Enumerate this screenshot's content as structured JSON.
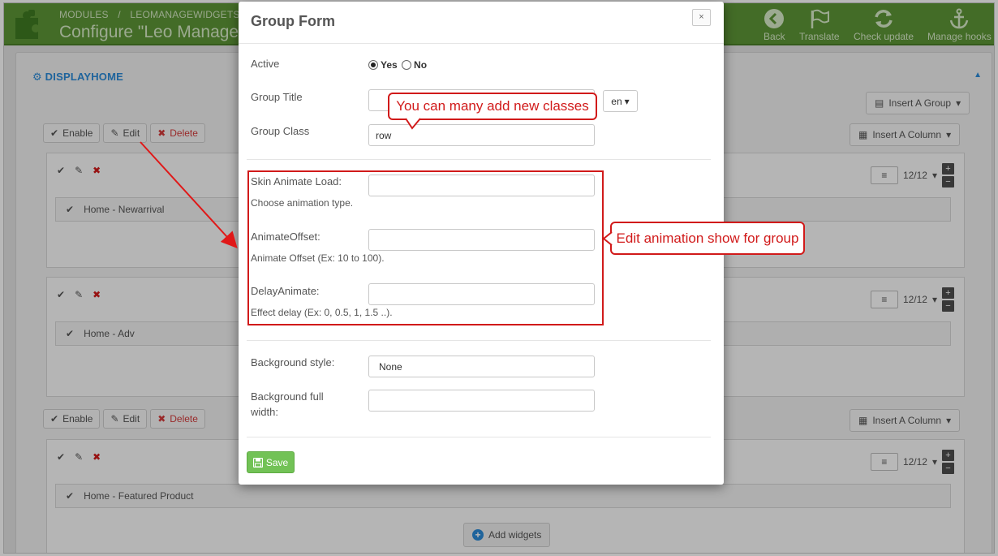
{
  "admin": {
    "breadcrumb": [
      "MODULES",
      "/",
      "LEOMANAGEWIDGETS",
      "/"
    ],
    "page_title": "Configure \"Leo Manage W",
    "toolbar": [
      {
        "label": "Back",
        "icon": "back-arrow-icon"
      },
      {
        "label": "Translate",
        "icon": "flag-icon"
      },
      {
        "label": "Check update",
        "icon": "refresh-icon"
      },
      {
        "label": "Manage hooks",
        "icon": "anchor-icon"
      }
    ],
    "panel_title": "DISPLAYHOME",
    "insert_group": "Insert A Group",
    "insert_column": "Insert A Column",
    "enable": "Enable",
    "edit": "Edit",
    "delete": "Delete",
    "width_value": "12/12",
    "columns": [
      "Home - Newarrival",
      "Home - Adv",
      "Home - Featured Product"
    ],
    "add_widgets": "Add widgets"
  },
  "modal": {
    "title": "Group Form",
    "close": "×",
    "active_label": "Active",
    "yes": "Yes",
    "no": "No",
    "group_title_label": "Group Title",
    "group_title_value": "",
    "lang": "en",
    "group_class_label": "Group Class",
    "group_class_value": "row",
    "skin_label": "Skin Animate Load:",
    "skin_help": "Choose animation type.",
    "offset_label": "AnimateOffset:",
    "offset_help": "Animate Offset (Ex: 10 to 100).",
    "delay_label": "DelayAnimate:",
    "delay_help": "Effect delay (Ex: 0, 0.5, 1, 1.5 ..).",
    "bg_style_label": "Background style:",
    "bg_style_value": "None",
    "bg_full_label_1": "Background full",
    "bg_full_label_2": "width:",
    "bg_full_value": "",
    "save": "Save"
  },
  "annotations": {
    "classes_note": "You can many add new classes",
    "animation_note": "Edit animation show for group"
  },
  "colors": {
    "topbar": "#5e9637",
    "accent": "#2b8bd8",
    "annotation": "#d11a1a",
    "save": "#72c256",
    "delete": "#d43b3b"
  }
}
